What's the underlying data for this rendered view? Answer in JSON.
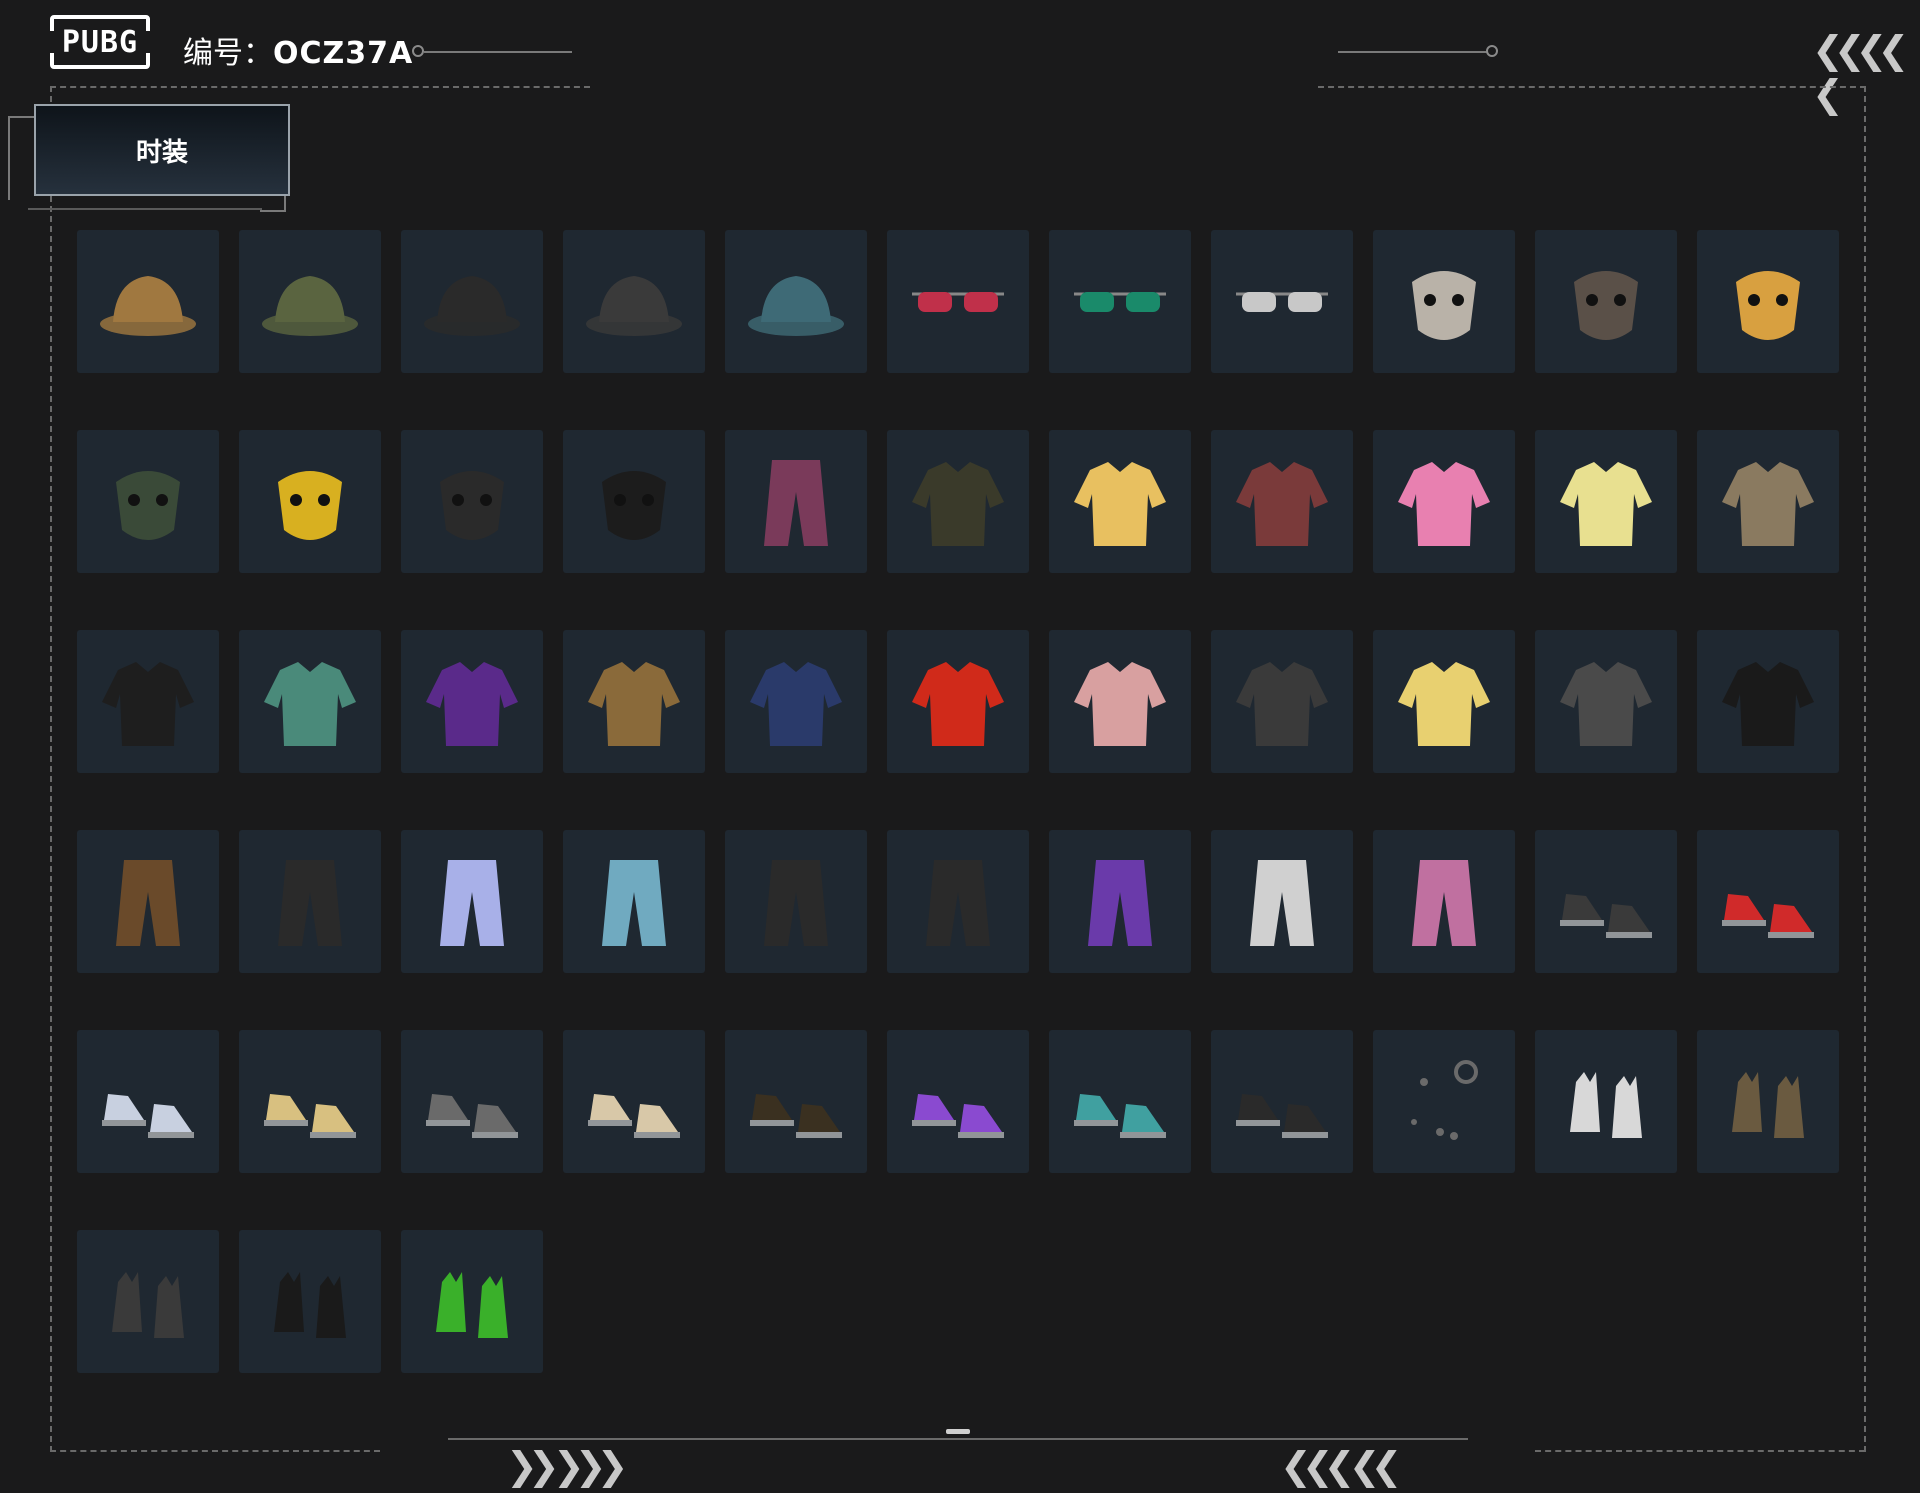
{
  "header": {
    "logo_text": "PUBG",
    "code_label": "编号：",
    "code_value": "OCZ37A"
  },
  "tabs": [
    {
      "label": "时装",
      "active": true
    }
  ],
  "colors": {
    "background": "#1a1a1b",
    "item_bg": "#1f2831",
    "tab_bg": "#26313d"
  },
  "items": [
    {
      "icon": "leopard-bucket-hat-icon",
      "color": "#a07840"
    },
    {
      "icon": "military-cap-headset-icon",
      "color": "#5a6440"
    },
    {
      "icon": "black-baseball-cap-icon",
      "color": "#2a2a2a"
    },
    {
      "icon": "black-patterned-cap-icon",
      "color": "#3a3a3a"
    },
    {
      "icon": "teal-boonie-hat-icon",
      "color": "#3e6a76"
    },
    {
      "icon": "gradient-sunglasses-icon",
      "color": "#c0304a"
    },
    {
      "icon": "green-visor-glasses-icon",
      "color": "#1a8a6a"
    },
    {
      "icon": "heart-sunglasses-icon",
      "color": "#c8c8c8"
    },
    {
      "icon": "cat-face-mask-icon",
      "color": "#b9b2a8"
    },
    {
      "icon": "fox-mask-icon",
      "color": "#5a5048"
    },
    {
      "icon": "rabbit-mask-icon",
      "color": "#d8a040"
    },
    {
      "icon": "camo-face-scarf-icon",
      "color": "#3a4a38"
    },
    {
      "icon": "yellow-gas-mask-icon",
      "color": "#d8b020"
    },
    {
      "icon": "black-tactical-mask-icon",
      "color": "#2a2a2a"
    },
    {
      "icon": "shark-teeth-mask-icon",
      "color": "#1c1c1c"
    },
    {
      "icon": "tank-top-skirt-icon",
      "color": "#7a3a5a"
    },
    {
      "icon": "black-gold-jacket-icon",
      "color": "#3a3a2a"
    },
    {
      "icon": "comic-dress-icon",
      "color": "#e8c060"
    },
    {
      "icon": "floral-kimono-dress-icon",
      "color": "#7a3a3a"
    },
    {
      "icon": "pink-white-jacket-icon",
      "color": "#e880b0"
    },
    {
      "icon": "chick-tshirt-icon",
      "color": "#e8e090"
    },
    {
      "icon": "paisley-suit-jacket-icon",
      "color": "#8a7a60"
    },
    {
      "icon": "black-dress-shirt-icon",
      "color": "#1e1e1e"
    },
    {
      "icon": "floral-shirt-icon",
      "color": "#4a8a7a"
    },
    {
      "icon": "purple-cat-hoodie-icon",
      "color": "#5a2a8a"
    },
    {
      "icon": "leopard-coat-icon",
      "color": "#8a6a3a"
    },
    {
      "icon": "navy-sweatshirt-icon",
      "color": "#2a3a6a"
    },
    {
      "icon": "red-varsity-jacket-icon",
      "color": "#d02a1a"
    },
    {
      "icon": "pink-bomber-jacket-icon",
      "color": "#d8a0a0"
    },
    {
      "icon": "black-graphic-hoodie-icon",
      "color": "#3a3a3a"
    },
    {
      "icon": "yellow-fluffy-sweater-icon",
      "color": "#e8d070"
    },
    {
      "icon": "gray-hooded-jacket-icon",
      "color": "#4a4a4a"
    },
    {
      "icon": "black-checker-hoodie-icon",
      "color": "#1a1a1a"
    },
    {
      "icon": "leopard-shorts-icon",
      "color": "#6a4a2a"
    },
    {
      "icon": "black-skinny-pants-icon",
      "color": "#2a2a2a"
    },
    {
      "icon": "lavender-cargo-pants-icon",
      "color": "#a8b0e8"
    },
    {
      "icon": "denim-shorts-icon",
      "color": "#70aac0"
    },
    {
      "icon": "black-gold-joggers-icon",
      "color": "#2a2a2a"
    },
    {
      "icon": "black-red-pants-icon",
      "color": "#2a2a2a"
    },
    {
      "icon": "purple-leggings-icon",
      "color": "#6a3aaa"
    },
    {
      "icon": "white-shorts-icon",
      "color": "#d0d0d0"
    },
    {
      "icon": "pink-boots-stockings-icon",
      "color": "#c070a0"
    },
    {
      "icon": "fur-leopard-boots-icon",
      "color": "#3a3a3a"
    },
    {
      "icon": "red-white-sneakers-icon",
      "color": "#d02a2a"
    },
    {
      "icon": "blue-white-high-tops-icon",
      "color": "#c8d0e0"
    },
    {
      "icon": "tan-sneakers-icon",
      "color": "#d8c080"
    },
    {
      "icon": "gray-orange-sneakers-icon",
      "color": "#6a6a6a"
    },
    {
      "icon": "lace-up-flats-icon",
      "color": "#d8c8a8"
    },
    {
      "icon": "black-combat-boots-icon",
      "color": "#3a3020"
    },
    {
      "icon": "purple-running-shoes-icon",
      "color": "#8a4ad0"
    },
    {
      "icon": "teal-clogs-icon",
      "color": "#40a0a0"
    },
    {
      "icon": "fur-lined-boots-icon",
      "color": "#2a2a2a"
    },
    {
      "icon": "jewelry-set-icon",
      "color": "#6a6a6a"
    },
    {
      "icon": "white-black-gloves-icon",
      "color": "#d8d8d8"
    },
    {
      "icon": "ornate-gloves-icon",
      "color": "#6a5a40"
    },
    {
      "icon": "fingerless-gloves-icon",
      "color": "#3a3a3a"
    },
    {
      "icon": "black-leather-gloves-icon",
      "color": "#1a1a1a"
    },
    {
      "icon": "green-gloves-icon",
      "color": "#3ab02a"
    }
  ]
}
